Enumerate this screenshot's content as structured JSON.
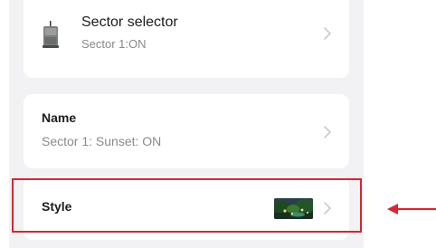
{
  "sector_card": {
    "title": "Sector selector",
    "subtitle": "Sector 1:ON"
  },
  "name_card": {
    "title": "Name",
    "subtitle": "Sector 1: Sunset: ON"
  },
  "style_card": {
    "title": "Style"
  },
  "icons": {
    "device": "device-icon",
    "chevron": "chevron-right-icon",
    "style_thumbnail": "garden-scene-thumbnail",
    "pointer": "arrow-left-icon"
  },
  "colors": {
    "highlight": "#d62632",
    "background": "#f2f2f4",
    "card": "#ffffff",
    "title_text": "#1c1c1e",
    "subtitle_text": "#8a8a8e"
  }
}
